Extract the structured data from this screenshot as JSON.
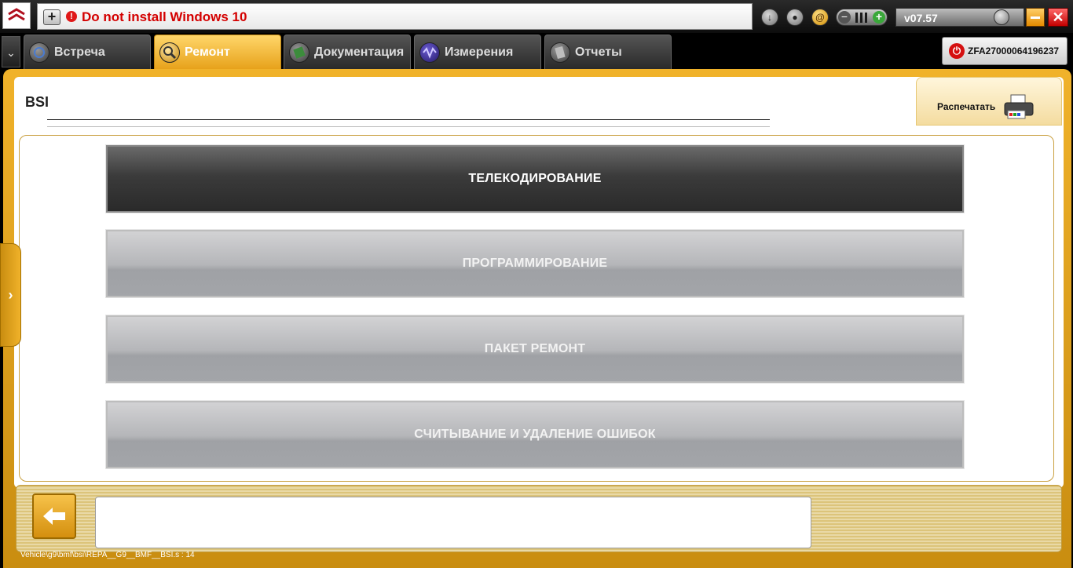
{
  "topbar": {
    "logo_icon": "citroen-logo-icon",
    "notice_text": "Do not install Windows 10",
    "version": "v07.57"
  },
  "tabs": [
    {
      "label": "Встреча",
      "icon": "meeting-icon",
      "active": false
    },
    {
      "label": "Ремонт",
      "icon": "magnifier-icon",
      "active": true
    },
    {
      "label": "Документация",
      "icon": "book-icon",
      "active": false
    },
    {
      "label": "Измерения",
      "icon": "waveform-icon",
      "active": false
    },
    {
      "label": "Отчеты",
      "icon": "document-icon",
      "active": false
    }
  ],
  "vin": "ZFA27000064196237",
  "panel": {
    "title": "BSI",
    "print_label": "Распечатать"
  },
  "menu": [
    {
      "label": "ТЕЛЕКОДИРОВАНИЕ",
      "selected": true
    },
    {
      "label": "ПРОГРАММИРОВАНИЕ",
      "selected": false
    },
    {
      "label": "ПАКЕТ РЕМОНТ",
      "selected": false
    },
    {
      "label": "СЧИТЫВАНИЕ И УДАЛЕНИЕ ОШИБОК",
      "selected": false
    }
  ],
  "footer": {
    "message": "",
    "path": "Vehicle\\g9\\bmf\\bsi\\REPA__G9__BMF__BSI.s : 14"
  },
  "colors": {
    "accent": "#f0b22a",
    "alert": "#d40000",
    "dark_button": "#2a2a2a",
    "gray_button": "#b5b6b9"
  }
}
